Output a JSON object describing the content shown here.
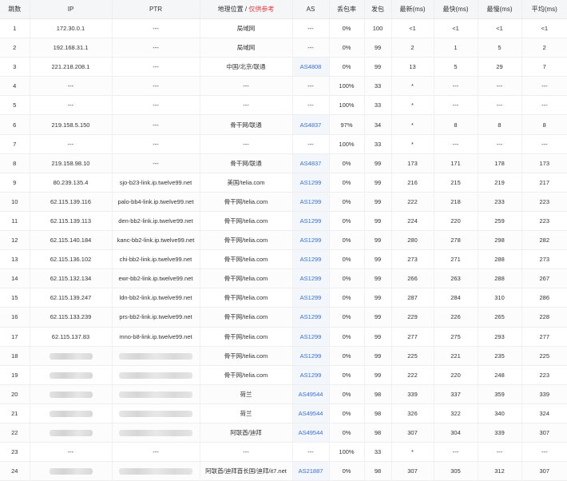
{
  "header": {
    "hop": "跳数",
    "ip": "IP",
    "ptr": "PTR",
    "geo": "地理位置",
    "geo_sep": " / ",
    "geo_note": "仅供参考",
    "as": "AS",
    "loss": "丢包率",
    "sent": "发包",
    "last": "最新(ms)",
    "best": "最快(ms)",
    "worst": "最慢(ms)",
    "avg": "平均(ms)"
  },
  "rows": [
    {
      "hop": "1",
      "ip": "172.30.0.1",
      "ptr": "---",
      "geo": "局域网",
      "as": "---",
      "loss": "0%",
      "sent": "100",
      "last": "<1",
      "best": "<1",
      "worst": "<1",
      "avg": "<1"
    },
    {
      "hop": "2",
      "ip": "192.168.31.1",
      "ptr": "---",
      "geo": "局域网",
      "as": "---",
      "loss": "0%",
      "sent": "99",
      "last": "2",
      "best": "1",
      "worst": "5",
      "avg": "2"
    },
    {
      "hop": "3",
      "ip": "221.218.208.1",
      "ptr": "---",
      "geo": "中国/北京/联通",
      "as": "AS4808",
      "loss": "0%",
      "sent": "99",
      "last": "13",
      "best": "5",
      "worst": "29",
      "avg": "7"
    },
    {
      "hop": "4",
      "ip": "---",
      "ptr": "---",
      "geo": "---",
      "as": "---",
      "loss": "100%",
      "sent": "33",
      "last": "*",
      "best": "---",
      "worst": "---",
      "avg": "---"
    },
    {
      "hop": "5",
      "ip": "---",
      "ptr": "---",
      "geo": "---",
      "as": "---",
      "loss": "100%",
      "sent": "33",
      "last": "*",
      "best": "---",
      "worst": "---",
      "avg": "---"
    },
    {
      "hop": "6",
      "ip": "219.158.5.150",
      "ptr": "---",
      "geo": "骨干网/联通",
      "as": "AS4837",
      "loss": "97%",
      "sent": "34",
      "last": "*",
      "best": "8",
      "worst": "8",
      "avg": "8"
    },
    {
      "hop": "7",
      "ip": "---",
      "ptr": "---",
      "geo": "---",
      "as": "---",
      "loss": "100%",
      "sent": "33",
      "last": "*",
      "best": "---",
      "worst": "---",
      "avg": "---"
    },
    {
      "hop": "8",
      "ip": "219.158.98.10",
      "ptr": "---",
      "geo": "骨干网/联通",
      "as": "AS4837",
      "loss": "0%",
      "sent": "99",
      "last": "173",
      "best": "171",
      "worst": "178",
      "avg": "173"
    },
    {
      "hop": "9",
      "ip": "80.239.135.4",
      "ptr": "sjo-b23-link.ip.twelve99.net",
      "geo": "美国/telia.com",
      "as": "AS1299",
      "loss": "0%",
      "sent": "99",
      "last": "216",
      "best": "215",
      "worst": "219",
      "avg": "217"
    },
    {
      "hop": "10",
      "ip": "62.115.139.116",
      "ptr": "palo-bb4-link.ip.twelve99.net",
      "geo": "骨干网/telia.com",
      "as": "AS1299",
      "loss": "0%",
      "sent": "99",
      "last": "222",
      "best": "218",
      "worst": "233",
      "avg": "223"
    },
    {
      "hop": "11",
      "ip": "62.115.139.113",
      "ptr": "den-bb2-link.ip.twelve99.net",
      "geo": "骨干网/telia.com",
      "as": "AS1299",
      "loss": "0%",
      "sent": "99",
      "last": "224",
      "best": "220",
      "worst": "259",
      "avg": "223"
    },
    {
      "hop": "12",
      "ip": "62.115.140.184",
      "ptr": "kanc-bb2-link.ip.twelve99.net",
      "geo": "骨干网/telia.com",
      "as": "AS1299",
      "loss": "0%",
      "sent": "99",
      "last": "280",
      "best": "278",
      "worst": "298",
      "avg": "282"
    },
    {
      "hop": "13",
      "ip": "62.115.136.102",
      "ptr": "chi-bb2-link.ip.twelve99.net",
      "geo": "骨干网/telia.com",
      "as": "AS1299",
      "loss": "0%",
      "sent": "99",
      "last": "273",
      "best": "271",
      "worst": "288",
      "avg": "273"
    },
    {
      "hop": "14",
      "ip": "62.115.132.134",
      "ptr": "ewr-bb2-link.ip.twelve99.net",
      "geo": "骨干网/telia.com",
      "as": "AS1299",
      "loss": "0%",
      "sent": "99",
      "last": "266",
      "best": "263",
      "worst": "288",
      "avg": "267"
    },
    {
      "hop": "15",
      "ip": "62.115.139.247",
      "ptr": "ldn-bb2-link.ip.twelve99.net",
      "geo": "骨干网/telia.com",
      "as": "AS1299",
      "loss": "0%",
      "sent": "99",
      "last": "287",
      "best": "284",
      "worst": "310",
      "avg": "286"
    },
    {
      "hop": "16",
      "ip": "62.115.133.239",
      "ptr": "prs-bb2-link.ip.twelve99.net",
      "geo": "骨干网/telia.com",
      "as": "AS1299",
      "loss": "0%",
      "sent": "99",
      "last": "229",
      "best": "226",
      "worst": "265",
      "avg": "228"
    },
    {
      "hop": "17",
      "ip": "62.115.137.83",
      "ptr": "mno-b8-link.ip.twelve99.net",
      "geo": "骨干网/telia.com",
      "as": "AS1299",
      "loss": "0%",
      "sent": "99",
      "last": "277",
      "best": "275",
      "worst": "293",
      "avg": "277"
    },
    {
      "hop": "18",
      "ip": "",
      "ptr": "",
      "geo": "骨干网/telia.com",
      "as": "AS1299",
      "loss": "0%",
      "sent": "99",
      "last": "225",
      "best": "221",
      "worst": "235",
      "avg": "225"
    },
    {
      "hop": "19",
      "ip": "",
      "ptr": "",
      "geo": "骨干网/telia.com",
      "as": "AS1299",
      "loss": "0%",
      "sent": "99",
      "last": "222",
      "best": "220",
      "worst": "248",
      "avg": "223"
    },
    {
      "hop": "20",
      "ip": "",
      "ptr": "",
      "geo": "荷兰",
      "as": "AS49544",
      "loss": "0%",
      "sent": "98",
      "last": "339",
      "best": "337",
      "worst": "359",
      "avg": "339"
    },
    {
      "hop": "21",
      "ip": "",
      "ptr": "",
      "geo": "荷兰",
      "as": "AS49544",
      "loss": "0%",
      "sent": "98",
      "last": "326",
      "best": "322",
      "worst": "340",
      "avg": "324"
    },
    {
      "hop": "22",
      "ip": "",
      "ptr": "",
      "geo": "阿联酋/迪拜",
      "as": "AS49544",
      "loss": "0%",
      "sent": "98",
      "last": "307",
      "best": "304",
      "worst": "339",
      "avg": "307"
    },
    {
      "hop": "23",
      "ip": "---",
      "ptr": "---",
      "geo": "---",
      "as": "---",
      "loss": "100%",
      "sent": "33",
      "last": "*",
      "best": "---",
      "worst": "---",
      "avg": "---"
    },
    {
      "hop": "24",
      "ip": "",
      "ptr": "",
      "geo": "阿联酋/迪拜酋长国/迪拜/it7.net",
      "as": "AS21887",
      "loss": "0%",
      "sent": "98",
      "last": "307",
      "best": "305",
      "worst": "312",
      "avg": "307"
    }
  ],
  "colors": {
    "header_bg": "#f5f6f7",
    "as_link": "#3b6fd6",
    "warning": "#e4393c",
    "as_cell_bg": "#f3f6fb"
  }
}
